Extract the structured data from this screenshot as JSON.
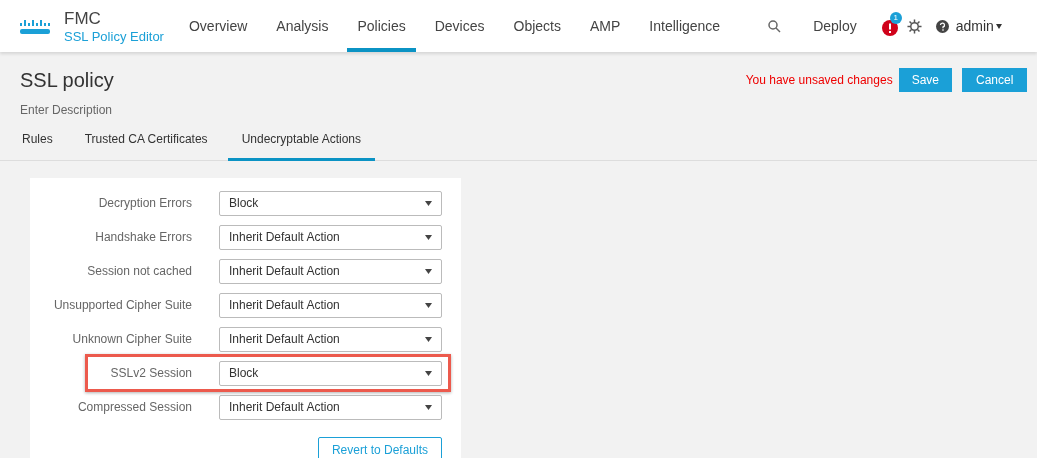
{
  "header": {
    "brand": "FMC",
    "subtitle": "SSL Policy Editor",
    "nav": [
      {
        "label": "Overview",
        "selected": false
      },
      {
        "label": "Analysis",
        "selected": false
      },
      {
        "label": "Policies",
        "selected": true
      },
      {
        "label": "Devices",
        "selected": false
      },
      {
        "label": "Objects",
        "selected": false
      },
      {
        "label": "AMP",
        "selected": false
      },
      {
        "label": "Intelligence",
        "selected": false
      }
    ],
    "deploy": "Deploy",
    "alert_count": "1",
    "user": "admin"
  },
  "page": {
    "title": "SSL policy",
    "description": "Enter Description",
    "unsaved_message": "You have unsaved changes",
    "buttons": [
      "Save",
      "Cancel"
    ]
  },
  "tabs": [
    {
      "label": "Rules",
      "selected": false
    },
    {
      "label": "Trusted CA Certificates",
      "selected": false
    },
    {
      "label": "Undecryptable Actions",
      "selected": true
    }
  ],
  "actions": [
    {
      "label": "Decryption Errors",
      "value": "Block",
      "highlighted": false
    },
    {
      "label": "Handshake Errors",
      "value": "Inherit Default Action",
      "highlighted": false
    },
    {
      "label": "Session not cached",
      "value": "Inherit Default Action",
      "highlighted": false
    },
    {
      "label": "Unsupported Cipher Suite",
      "value": "Inherit Default Action",
      "highlighted": false
    },
    {
      "label": "Unknown Cipher Suite",
      "value": "Inherit Default Action",
      "highlighted": false
    },
    {
      "label": "SSLv2 Session",
      "value": "Block",
      "highlighted": true
    },
    {
      "label": "Compressed Session",
      "value": "Inherit Default Action",
      "highlighted": false
    }
  ],
  "revert_button": "Revert to Defaults"
}
